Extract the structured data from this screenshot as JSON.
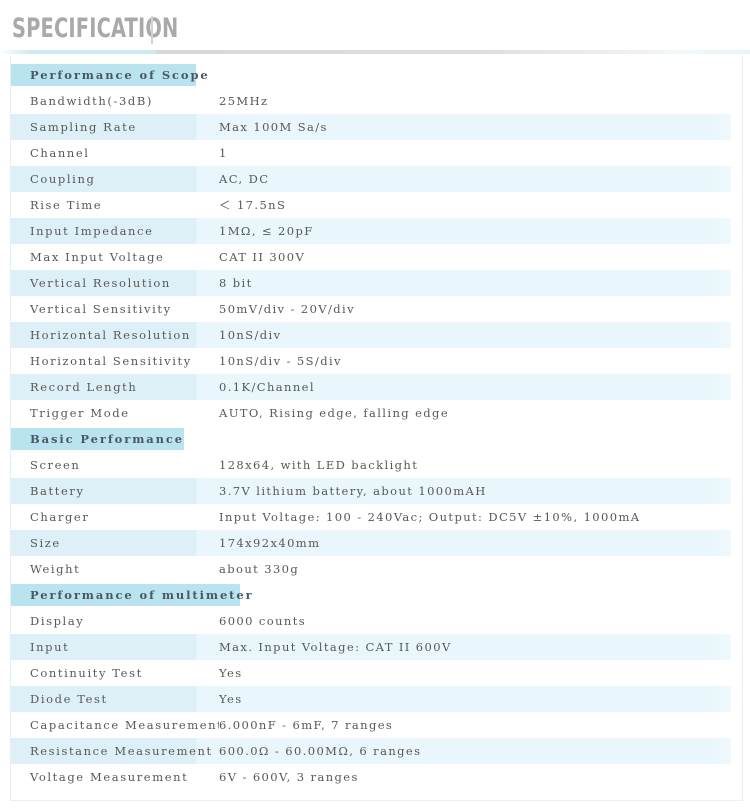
{
  "header": {
    "title": "SPECIFICATION"
  },
  "colors": {
    "title_gray": "#a9a9a9",
    "section_header_bg": "#b9e4ef",
    "section_header_text": "#4a5864",
    "stripe_label_bg": "#ddf0f7",
    "stripe_value_bg": "#e9f6fb",
    "body_text": "#585858",
    "rule_blue": "#cfeaf4",
    "rule_gray": "#dedede"
  },
  "spec": {
    "sections": [
      {
        "title": "Performance of Scope",
        "rows": [
          {
            "label": "Bandwidth(-3dB)",
            "value": "25MHz"
          },
          {
            "label": "Sampling Rate",
            "value": "Max 100M Sa/s"
          },
          {
            "label": "Channel",
            "value": "1"
          },
          {
            "label": "Coupling",
            "value": "AC, DC"
          },
          {
            "label": "Rise Time",
            "value": "＜ 17.5nS"
          },
          {
            "label": "Input Impedance",
            "value": "1MΩ, ≤ 20pF"
          },
          {
            "label": "Max Input Voltage",
            "value": "CAT II 300V"
          },
          {
            "label": "Vertical Resolution",
            "value": "8 bit"
          },
          {
            "label": "Vertical Sensitivity",
            "value": "50mV/div - 20V/div"
          },
          {
            "label": "Horizontal Resolution",
            "value": "10nS/div"
          },
          {
            "label": "Horizontal Sensitivity",
            "value": "10nS/div - 5S/div"
          },
          {
            "label": "Record Length",
            "value": "0.1K/Channel"
          },
          {
            "label": "Trigger Mode",
            "value": "AUTO, Rising edge, falling edge"
          }
        ]
      },
      {
        "title": "Basic Performance",
        "rows": [
          {
            "label": "Screen",
            "value": "128x64, with LED backlight"
          },
          {
            "label": "Battery",
            "value": "3.7V lithium battery, about 1000mAH"
          },
          {
            "label": "Charger",
            "value": "Input Voltage:  100 - 240Vac; Output:  DC5V ±10%, 1000mA"
          },
          {
            "label": "Size",
            "value": "174x92x40mm"
          },
          {
            "label": "Weight",
            "value": "about 330g"
          }
        ]
      },
      {
        "title": "Performance of multimeter",
        "rows": [
          {
            "label": "Display",
            "value": "6000 counts"
          },
          {
            "label": "Input",
            "value": "Max. Input Voltage:  CAT II 600V"
          },
          {
            "label": "Continuity Test",
            "value": "Yes"
          },
          {
            "label": "Diode Test",
            "value": "Yes"
          },
          {
            "label": "Capacitance Measurement",
            "value": "6.000nF - 6mF, 7 ranges"
          },
          {
            "label": "Resistance Measurement",
            "value": "600.0Ω - 60.00MΩ, 6 ranges"
          },
          {
            "label": "Voltage Measurement",
            "value": "6V - 600V, 3 ranges"
          }
        ]
      }
    ]
  }
}
